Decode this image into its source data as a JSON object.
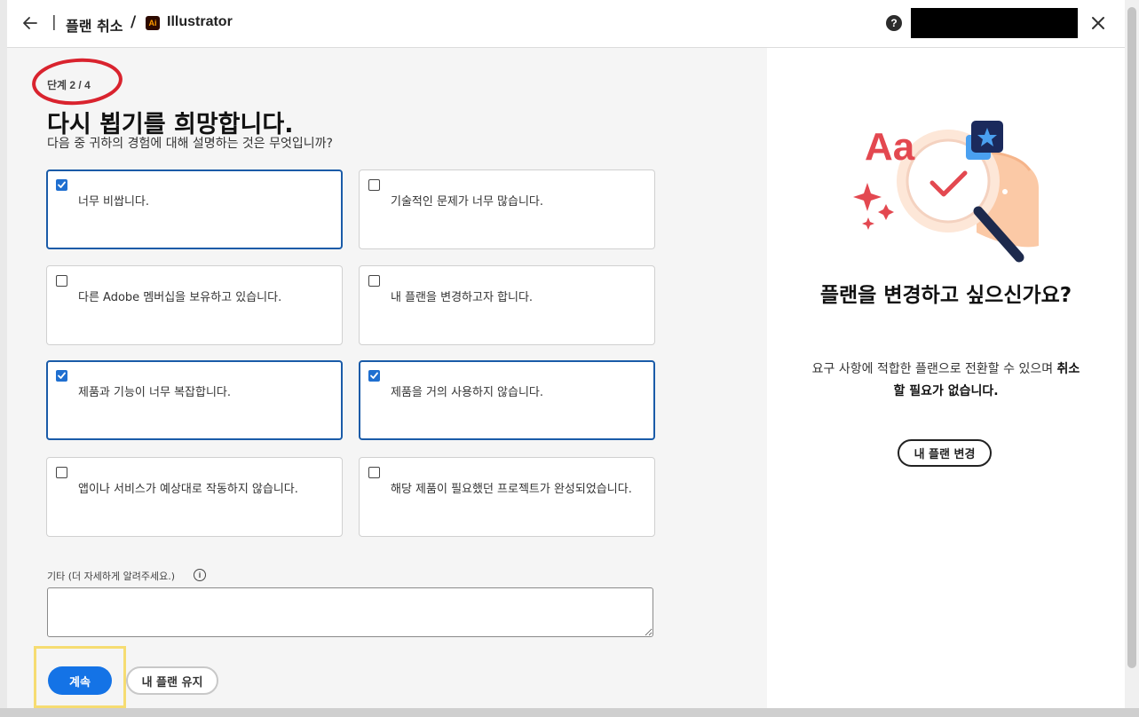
{
  "header": {
    "separator": "|",
    "title": "플랜 취소",
    "slash": "/",
    "app_logo_text": "Ai",
    "app_name": "Illustrator",
    "help_glyph": "?"
  },
  "step": {
    "label": "단계 2 / 4"
  },
  "main": {
    "title": "다시 뵙기를 희망합니다.",
    "subtitle": "다음 중 귀하의 경험에 대해 설명하는 것은 무엇입니까?"
  },
  "options": [
    {
      "label": "너무 비쌉니다.",
      "checked": true
    },
    {
      "label": "기술적인 문제가 너무 많습니다.",
      "checked": false
    },
    {
      "label": "다른 Adobe 멤버십을 보유하고 있습니다.",
      "checked": false
    },
    {
      "label": "내 플랜을 변경하고자 합니다.",
      "checked": false
    },
    {
      "label": "제품과 기능이 너무 복잡합니다.",
      "checked": true
    },
    {
      "label": "제품을 거의 사용하지 않습니다.",
      "checked": true
    },
    {
      "label": "앱이나 서비스가 예상대로 작동하지 않습니다.",
      "checked": false
    },
    {
      "label": "해당 제품이 필요했던 프로젝트가 완성되었습니다.",
      "checked": false
    }
  ],
  "other": {
    "label": "기타 (더 자세하게 알려주세요.)",
    "info_glyph": "i",
    "value": ""
  },
  "buttons": {
    "continue": "계속",
    "keep_plan": "내 플랜 유지"
  },
  "promo": {
    "title": "플랜을 변경하고 싶으신가요?",
    "body_prefix": "요구 사항에 적합한 플랜으로 전환할 수 있으며 ",
    "body_bold": "취소할 필요가 없습니다.",
    "button": "내 플랜 변경",
    "illustration_text": "Aa"
  },
  "colors": {
    "accent": "#1473e6",
    "checked_border": "#1a5ba8",
    "annotation_red": "#d9232e",
    "highlight_yellow": "#f6dc72"
  }
}
